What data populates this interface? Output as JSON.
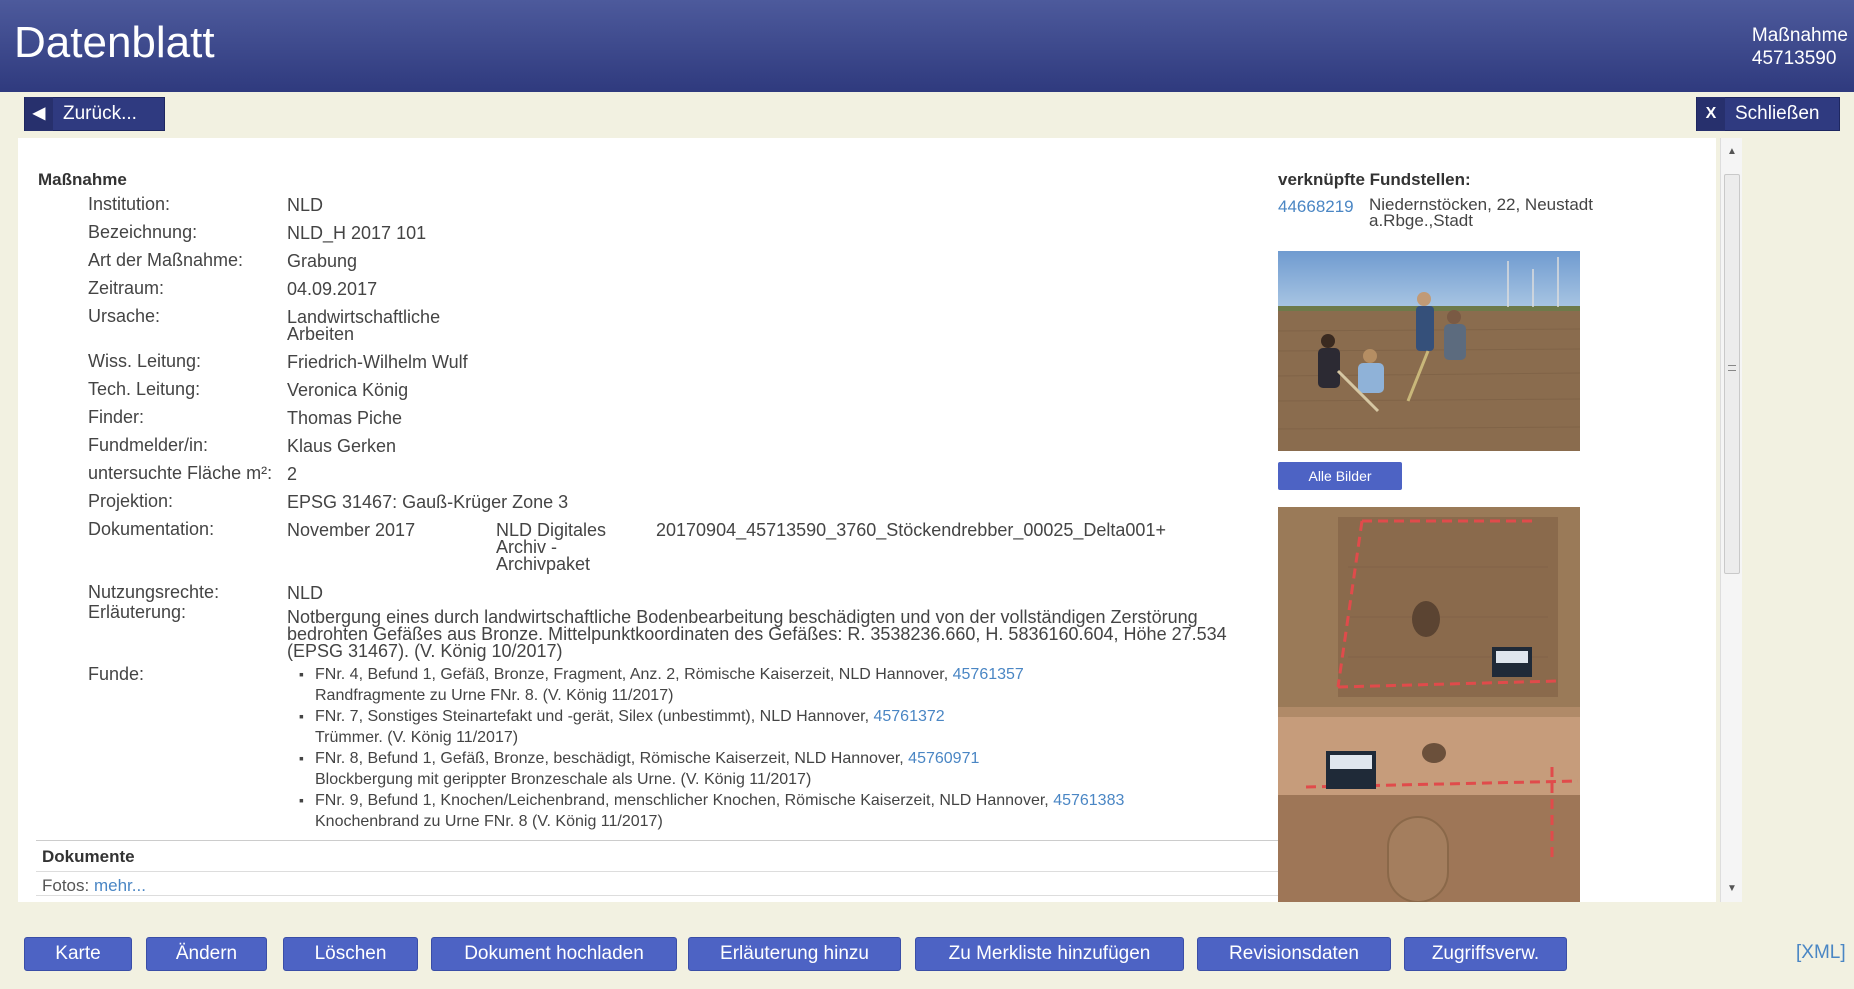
{
  "header": {
    "title": "Datenblatt",
    "right_line1": "Maßnahme",
    "right_line2": "45713590"
  },
  "nav": {
    "back_label": "Zurück...",
    "back_icon": "chevron-left-icon",
    "close_label": "Schließen",
    "close_icon_text": "X"
  },
  "massnahme": {
    "heading": "Maßnahme",
    "fields": [
      {
        "label": "Institution:",
        "value": "NLD"
      },
      {
        "label": "Bezeichnung:",
        "value": "NLD_H 2017 101"
      },
      {
        "label": "Art der Maßnahme:",
        "value": "Grabung"
      },
      {
        "label": "Zeitraum:",
        "value": "04.09.2017"
      },
      {
        "label": "Ursache:",
        "value": "Landwirtschaftliche Arbeiten"
      },
      {
        "label": "Wiss. Leitung:",
        "value": "Friedrich-Wilhelm Wulf"
      },
      {
        "label": "Tech. Leitung:",
        "value": "Veronica König"
      },
      {
        "label": "Finder:",
        "value": "Thomas Piche"
      },
      {
        "label": "Fundmelder/in:",
        "value": "Klaus Gerken"
      },
      {
        "label": "untersuchte Fläche m²:",
        "value": "2"
      },
      {
        "label": "Projektion:",
        "value": "EPSG 31467: Gauß-Krüger Zone 3"
      },
      {
        "label": "Dokumentation:",
        "value": "November 2017"
      },
      {
        "label": "Nutzungsrechte:",
        "value": "NLD"
      },
      {
        "label": "Erläuterung:",
        "value": "Notbergung eines durch landwirtschaftliche Bodenbearbeitung beschädigten und von der vollständigen Zerstörung bedrohten Gefäßes aus Bronze. Mittelpunktkoordinaten des Gefäßes: R. 3538236.660, H. 5836160.604, Höhe 27.534 (EPSG 31467). (V. König 10/2017)"
      },
      {
        "label": "Funde:",
        "value": ""
      }
    ],
    "doku_archiv": "NLD Digitales Archiv - Archivpaket",
    "doku_file": "20170904_45713590_3760_Stöckendrebber_00025_Delta001+"
  },
  "funde": [
    {
      "text": "FNr. 4, Befund 1, Gefäß, Bronze, Fragment, Anz. 2, Römische Kaiserzeit, NLD Hannover, ",
      "link": "45761357",
      "note": "Randfragmente zu Urne FNr. 8. (V. König 11/2017)"
    },
    {
      "text": "FNr. 7, Sonstiges Steinartefakt und -gerät, Silex (unbestimmt), NLD Hannover, ",
      "link": "45761372",
      "note": "Trümmer. (V. König 11/2017)"
    },
    {
      "text": "FNr. 8, Befund 1, Gefäß, Bronze, beschädigt, Römische Kaiserzeit, NLD Hannover, ",
      "link": "45760971",
      "note": "Blockbergung mit gerippter Bronzeschale als Urne. (V. König 11/2017)"
    },
    {
      "text": "FNr. 9, Befund 1, Knochen/Leichenbrand, menschlicher Knochen, Römische Kaiserzeit, NLD Hannover, ",
      "link": "45761383",
      "note": "Knochenbrand zu Urne FNr. 8 (V. König 11/2017)"
    }
  ],
  "dokumente": {
    "heading": "Dokumente",
    "fotos_label": "Fotos:",
    "fotos_link": "mehr..."
  },
  "fundstellen": {
    "heading": "verknüpfte Fundstellen:",
    "id_link": "44668219",
    "place": "Niedernstöcken, 22, Neustadt a.Rbge.,Stadt",
    "all_images_button": "Alle Bilder"
  },
  "footer_buttons": [
    "Karte",
    "Ändern",
    "Löschen",
    "Dokument hochladen",
    "Erläuterung hinzu",
    "Zu Merkliste hinzufügen",
    "Revisionsdaten",
    "Zugriffsverw."
  ],
  "footer_xml": "[XML]",
  "colors": {
    "header": "#2f3a7e",
    "button": "#4d63c4",
    "link": "#4a86c4",
    "background": "#f2f1e1"
  }
}
